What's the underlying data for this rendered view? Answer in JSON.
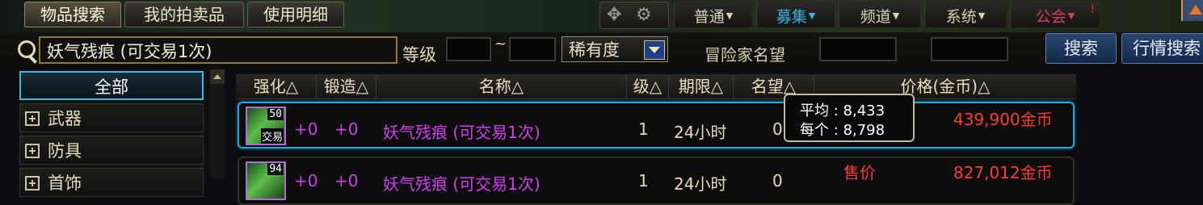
{
  "tabs": [
    {
      "label": "物品搜索",
      "active": true
    },
    {
      "label": "我的拍卖品",
      "active": false
    },
    {
      "label": "使用明细",
      "active": false
    }
  ],
  "menu_bar": {
    "items": [
      {
        "label": "普通",
        "color": "#d8d0b8"
      },
      {
        "label": "募集",
        "color": "#3ab0e6"
      },
      {
        "label": "频道",
        "color": "#d8d0b8"
      },
      {
        "label": "系统",
        "color": "#d8d0b8"
      },
      {
        "label": "公会",
        "color": "#d23f60"
      }
    ]
  },
  "search": {
    "query": "妖气残痕 (可交易1次)",
    "level_label": "等级",
    "range_sep": "~",
    "rarity_label": "稀有度",
    "search_button": "搜索",
    "market_button": "行情搜索",
    "ghost_text": "冒险家名望"
  },
  "categories": [
    {
      "label": "全部",
      "selected": true
    },
    {
      "label": "武器",
      "selected": false
    },
    {
      "label": "防具",
      "selected": false
    },
    {
      "label": "首饰",
      "selected": false
    }
  ],
  "table": {
    "headers": [
      "强化△",
      "锻造△",
      "名称△",
      "级△",
      "期限△",
      "名望△",
      "价格(金币)△"
    ],
    "rows": [
      {
        "icon_level": "50",
        "icon_tag": "交易",
        "enhance": "+0",
        "forge": "+0",
        "name": "妖气残痕 (可交易1次)",
        "level": "1",
        "period": "24小时",
        "fame": "0",
        "price": "439,900金币"
      },
      {
        "icon_level": "94",
        "enhance": "+0",
        "forge": "+0",
        "name": "妖气残痕 (可交易1次)",
        "level": "1",
        "period": "24小时",
        "fame": "0",
        "sell_label": "售价",
        "price": "827,012金币"
      }
    ]
  },
  "tooltip": {
    "avg_label": "平均",
    "avg_value": "8,433",
    "each_label": "每个",
    "each_value": "8,798"
  }
}
